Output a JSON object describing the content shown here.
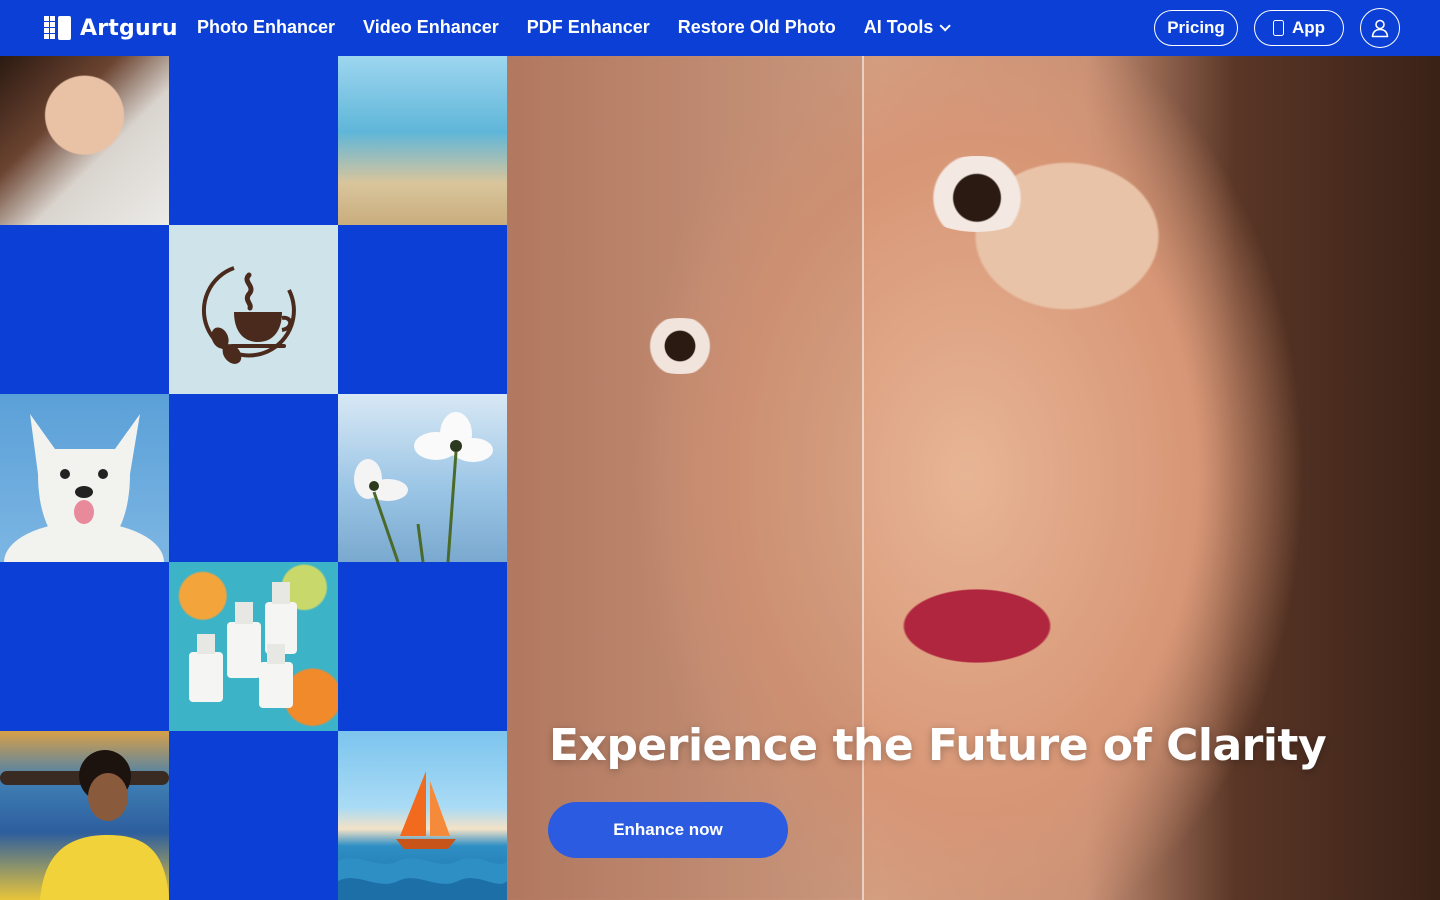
{
  "brand": {
    "name": "Artguru"
  },
  "nav": {
    "links": [
      "Photo Enhancer",
      "Video Enhancer",
      "PDF Enhancer",
      "Restore Old Photo"
    ],
    "ai_tools_label": "AI Tools",
    "pricing_label": "Pricing",
    "app_label": "App"
  },
  "hero": {
    "title": "Experience the Future of Clarity",
    "cta_label": "Enhance now"
  },
  "colors": {
    "brand_blue": "#0b3fd6",
    "cta_blue": "#2b5be0"
  },
  "icons": [
    "chevron-down-icon",
    "phone-icon",
    "user-icon",
    "coffee-logo-icon"
  ]
}
